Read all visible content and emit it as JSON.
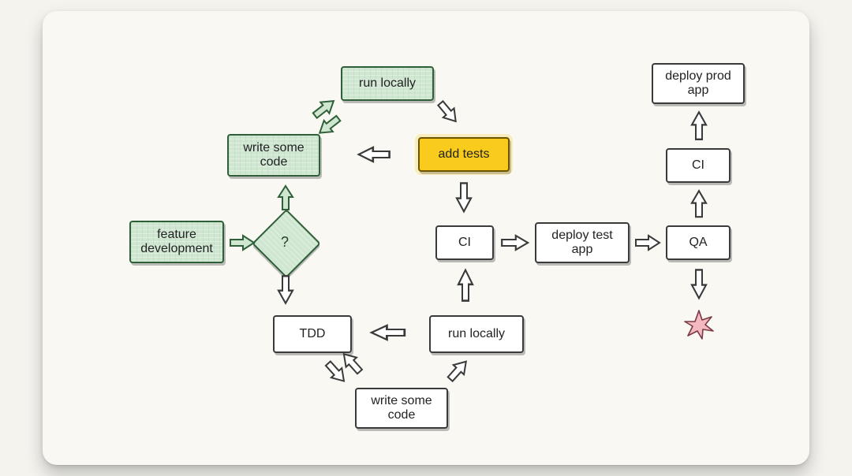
{
  "nodes": {
    "feature_dev": {
      "label": "feature\ndevelopment"
    },
    "decision": {
      "label": "?"
    },
    "write_code_a": {
      "label": "write some\ncode"
    },
    "run_locally_a": {
      "label": "run locally"
    },
    "add_tests": {
      "label": "add tests"
    },
    "ci_a": {
      "label": "CI"
    },
    "tdd": {
      "label": "TDD"
    },
    "write_code_b": {
      "label": "write some\ncode"
    },
    "run_locally_b": {
      "label": "run locally"
    },
    "deploy_test": {
      "label": "deploy test\napp"
    },
    "qa": {
      "label": "QA"
    },
    "ci_b": {
      "label": "CI"
    },
    "deploy_prod": {
      "label": "deploy prod\napp"
    },
    "burst": {
      "label": ""
    }
  },
  "colors": {
    "green_fill": "#cfe6d1",
    "green_stroke": "#2f5f38",
    "white_fill": "#ffffff",
    "white_stroke": "#3a3a3a",
    "yellow_fill": "#f8cb1c",
    "pink_fill": "#f3b8c0"
  }
}
